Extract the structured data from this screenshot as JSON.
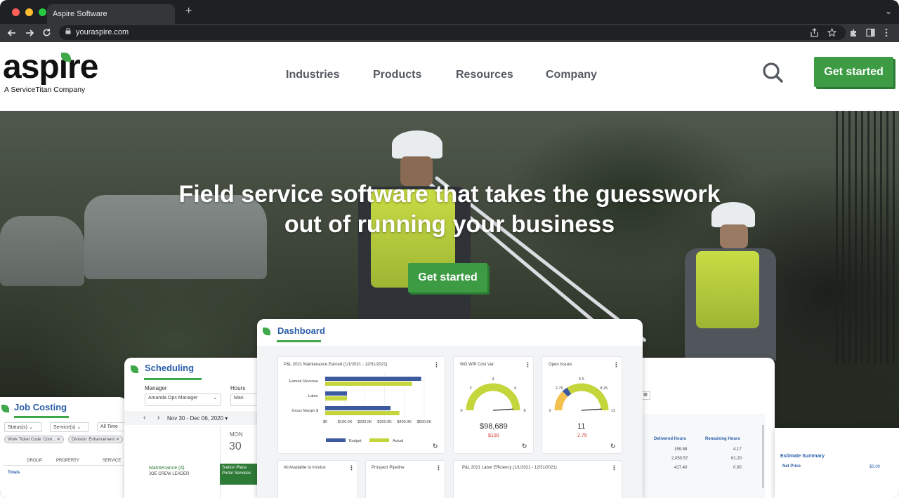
{
  "browser": {
    "tab_title": "Aspire Software",
    "new_tab": "+",
    "tab_menu": "⌄",
    "url": "youraspire.com",
    "colors": {
      "close": "#ff5f57",
      "minimize": "#febc2e",
      "maximize": "#28c840"
    }
  },
  "header": {
    "logo_word": "aspire",
    "logo_sub": "A ServiceTitan Company",
    "menu": [
      "Industries",
      "Products",
      "Resources",
      "Company"
    ],
    "cta": "Get started"
  },
  "hero": {
    "title": "Field service software that takes the guesswork out of running your business",
    "cta": "Get started"
  },
  "dashboard": {
    "title": "Dashboard",
    "pl_panel": {
      "title": "P&L 2021 Maintenance Earned (1/1/2021 - 12/31/2021)",
      "rows": [
        "Earned Revenue",
        "Labor",
        "Gross Margin $"
      ],
      "xticks": [
        "$0",
        "$100.0K",
        "$200.0K",
        "$300.0K",
        "$400.0K",
        "$500.0K"
      ],
      "legend": [
        "Budget",
        "Actual"
      ]
    },
    "wip_panel": {
      "title": "WO WIP Cost Var.",
      "value": "$98,689",
      "sub": "$100",
      "ticks": [
        "0",
        "2",
        "4",
        "6",
        "8"
      ]
    },
    "issues_panel": {
      "title": "Open Issues",
      "value": "11",
      "sub": "2.75",
      "ticks": [
        "0",
        "2.75",
        "5.5",
        "8.25",
        "11"
      ]
    },
    "bottom_panels": [
      "All Available to Invoice",
      "Prospect Pipeline",
      "P&L 2021 Labor Efficiency (1/1/2021 - 12/31/2021)"
    ]
  },
  "chart_data": {
    "type": "bar",
    "title": "P&L 2021 Maintenance Earned (1/1/2021 - 12/31/2021)",
    "categories": [
      "Earned Revenue",
      "Labor",
      "Gross Margin $"
    ],
    "series": [
      {
        "name": "Budget",
        "values": [
          485000,
          110000,
          330000
        ]
      },
      {
        "name": "Actual",
        "values": [
          438000,
          110000,
          375000
        ]
      }
    ],
    "xlim": [
      0,
      550000
    ],
    "colors": {
      "Budget": "#3d5a9e",
      "Actual": "#c5d63d"
    }
  },
  "scheduling": {
    "title": "Scheduling",
    "manager_label": "Manager",
    "manager_value": "Amanda Ops Manager",
    "hours_label": "Hours",
    "hours_value": "Man",
    "range": "Nov 30 - Dec 06, 2020",
    "day": "MON",
    "date": "30",
    "row_label": "Maintenance (4)",
    "row_sub": "JOE CREW LEADER",
    "event_line1": "Station Place",
    "event_line2": "Porter Services"
  },
  "job_costing": {
    "title": "Job Costing",
    "filters": [
      "Status(s)",
      "Service(s)",
      "All Time"
    ],
    "chips": [
      "Work Ticket Code: Com...",
      "Division: Enhancement"
    ],
    "columns": [
      "GROUP",
      "PROPERTY",
      "SERVICE"
    ],
    "totals": "Totals"
  },
  "right_card": {
    "col1": "Delivered Hours",
    "col2": "Remaining Hours",
    "rows": [
      [
        "159.88",
        "4.17"
      ],
      [
        "2,050.57",
        "61.20"
      ],
      [
        "417.40",
        "0.00"
      ]
    ],
    "estimate_title": "Estimate Summary",
    "net_price": "Net Price",
    "net_value": "$0.00"
  }
}
